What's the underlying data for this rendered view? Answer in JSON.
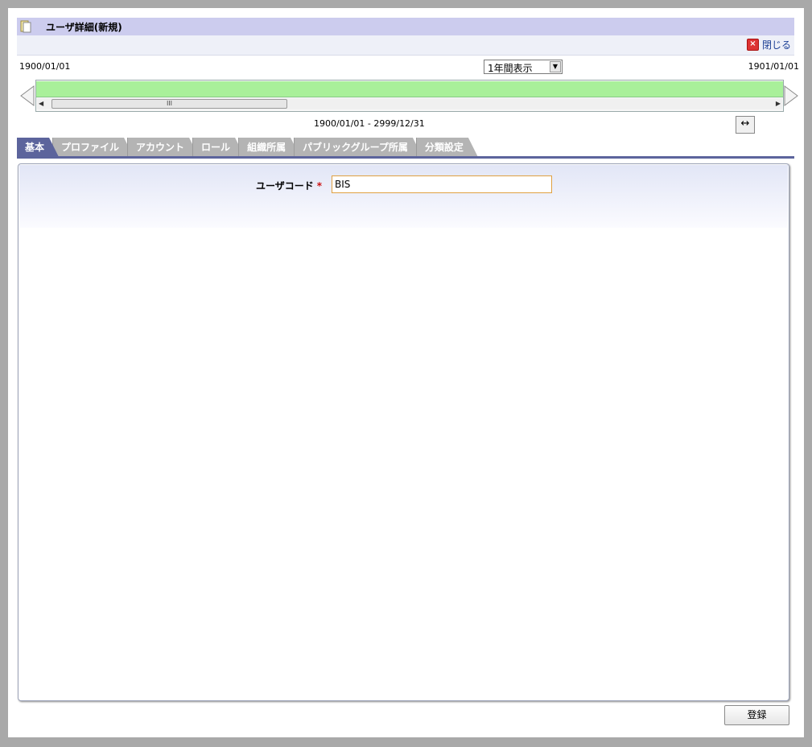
{
  "header": {
    "title": "ユーザ詳細(新規)",
    "icon": "document-icon"
  },
  "close": {
    "label": "閉じる",
    "icon": "close-icon"
  },
  "timeline": {
    "start_date": "1900/01/01",
    "end_date": "1901/01/01",
    "period_select": "1年間表示",
    "range": "1900/01/01 - 2999/12/31",
    "bar_color": "#a9f09a"
  },
  "tabs": [
    {
      "label": "基本",
      "active": true
    },
    {
      "label": "プロファイル",
      "active": false
    },
    {
      "label": "アカウント",
      "active": false
    },
    {
      "label": "ロール",
      "active": false
    },
    {
      "label": "組織所属",
      "active": false
    },
    {
      "label": "パブリックグループ所属",
      "active": false
    },
    {
      "label": "分類設定",
      "active": false
    }
  ],
  "form": {
    "user_code_label": "ユーザコード",
    "required_mark": "*",
    "user_code_value": "BIS"
  },
  "actions": {
    "register_label": "登録"
  },
  "colors": {
    "accent": "#5c649c",
    "title_bg": "#ccccee",
    "required": "#cc1111"
  }
}
